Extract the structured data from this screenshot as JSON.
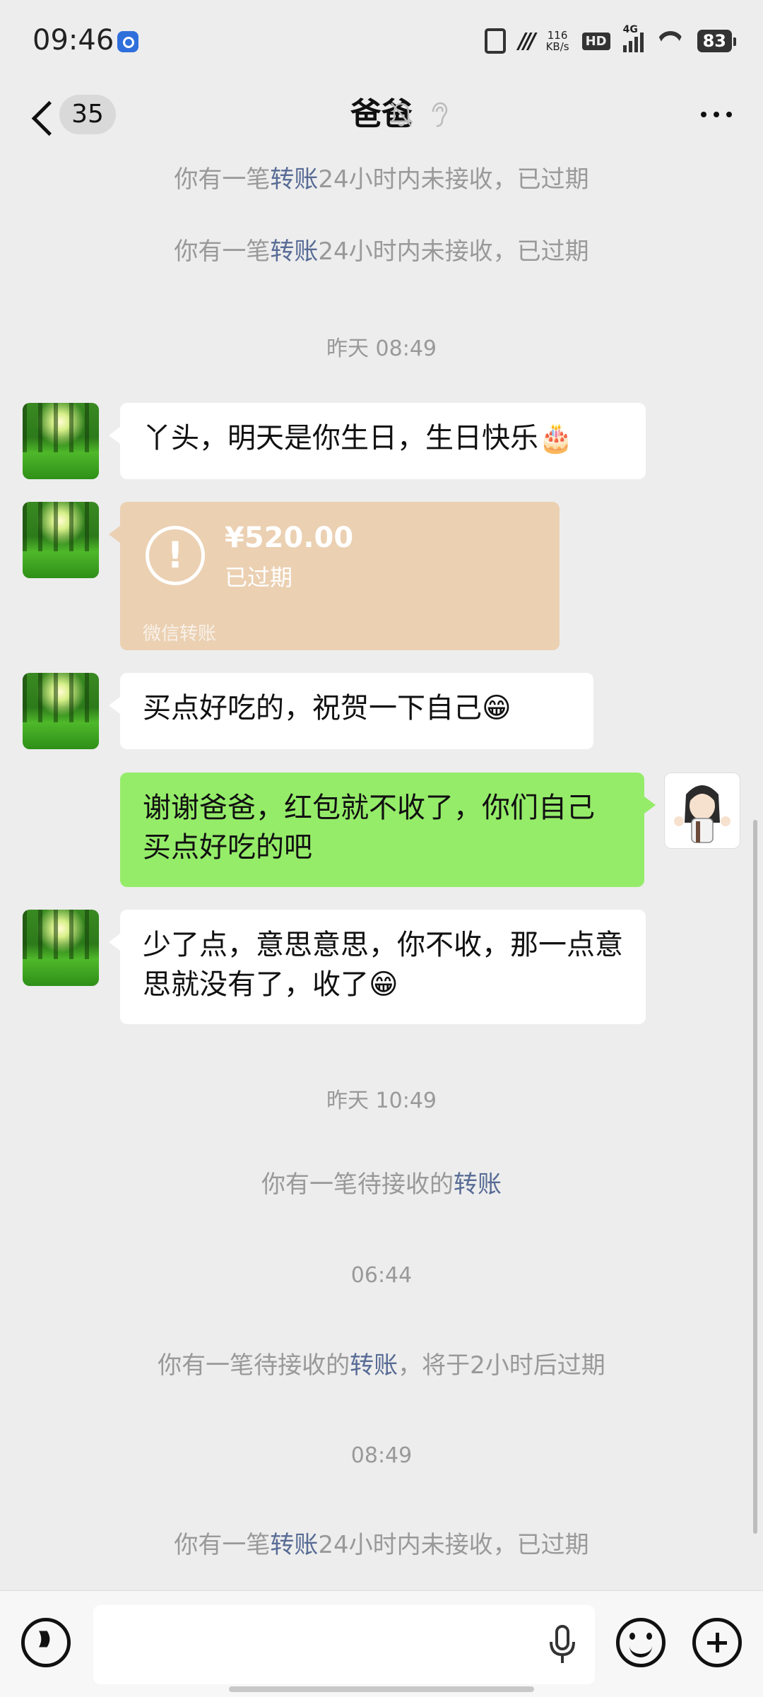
{
  "status_bar": {
    "time": "09:46",
    "net_speed_value": "116",
    "net_speed_unit": "KB/s",
    "hd": "HD",
    "network": "4G",
    "battery": "83"
  },
  "header": {
    "unread_count": "35",
    "title": "爸爸"
  },
  "messages": {
    "sys1": {
      "pre": "你有一笔",
      "link": "转账",
      "post": "24小时内未接收，已过期"
    },
    "sys2": {
      "pre": "你有一笔",
      "link": "转账",
      "post": "24小时内未接收，已过期"
    },
    "time1": "昨天 08:49",
    "m1": "丫头，明天是你生日，生日快乐🎂",
    "transfer": {
      "amount": "¥520.00",
      "status": "已过期",
      "label": "微信转账",
      "icon": "!"
    },
    "m2": "买点好吃的，祝贺一下自己😁",
    "m3": "谢谢爸爸，红包就不收了，你们自己买点好吃的吧",
    "m4": "少了点，意思意思，你不收，那一点意思就没有了，收了😁",
    "time2": "昨天 10:49",
    "sys3": {
      "pre": "你有一笔待接收的",
      "link": "转账"
    },
    "time3": "06:44",
    "sys4": {
      "pre": "你有一笔待接收的",
      "link": "转账",
      "post": "，将于2小时后过期"
    },
    "time4": "08:49",
    "sys5": {
      "pre": "你有一笔",
      "link": "转账",
      "post": "24小时内未接收，已过期"
    }
  },
  "input": {
    "value": ""
  },
  "icons": {
    "back": "chevron-left-icon",
    "mute": "bell-off-icon",
    "ear": "ear-icon",
    "more": "more-icon",
    "voice": "voice-icon",
    "mic": "mic-icon",
    "emoji": "emoji-icon",
    "plus": "plus-icon"
  },
  "colors": {
    "background": "#ededed",
    "my_bubble": "#95ec69",
    "their_bubble": "#ffffff",
    "transfer_card": "#ebd0b2",
    "link": "#576b95",
    "system_text": "#999999"
  }
}
